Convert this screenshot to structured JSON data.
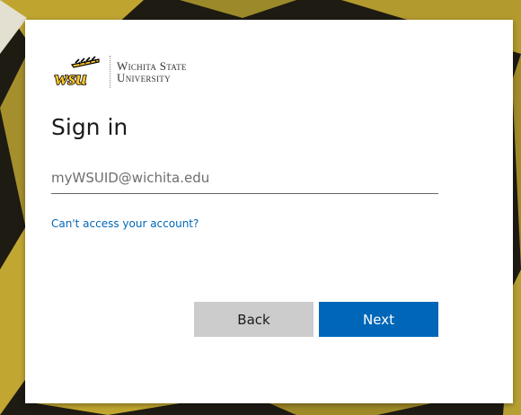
{
  "branding": {
    "logo_alt": "WSU",
    "university_line1": "Wichita State",
    "university_line2": "University"
  },
  "signin": {
    "title": "Sign in",
    "email_placeholder": "myWSUID@wichita.edu",
    "email_value": "",
    "cant_access_link": "Can't access your account?",
    "back_label": "Back",
    "next_label": "Next"
  },
  "colors": {
    "primary_button": "#0067b8",
    "secondary_button": "#cccccc",
    "link": "#0067b8",
    "brand_gold": "#ffc72c",
    "brand_black": "#000000"
  }
}
